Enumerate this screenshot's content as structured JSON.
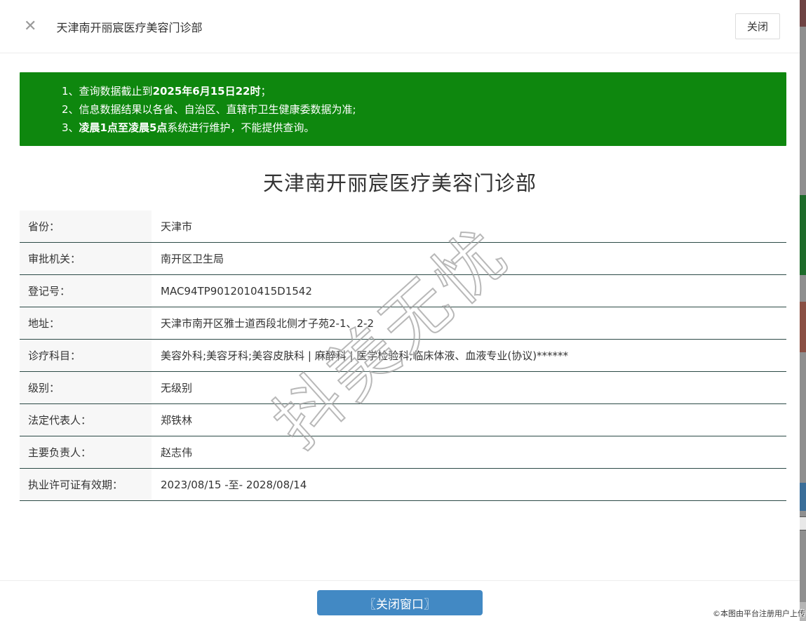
{
  "header": {
    "close_icon": "✕",
    "title": "天津南开丽宸医疗美容门诊部",
    "close_button_label": "关闭"
  },
  "notice": {
    "items": [
      {
        "num": "1、",
        "pre": "查询数据截止到",
        "bold": "2025年6月15日22时",
        "post": "；"
      },
      {
        "num": "2、",
        "pre": "信息数据结果以各省、自治区、直辖市卫生健康委数据为准;",
        "bold": "",
        "post": ""
      },
      {
        "num": "3、",
        "pre": "",
        "bold": "凌晨1点至凌晨5点",
        "post": "系统进行维护，不能提供查询。"
      }
    ]
  },
  "detail": {
    "title": "天津南开丽宸医疗美容门诊部",
    "rows": [
      {
        "label": "省份：",
        "value": "天津市"
      },
      {
        "label": "审批机关：",
        "value": "南开区卫生局"
      },
      {
        "label": "登记号：",
        "value": "MAC94TP9012010415D1542"
      },
      {
        "label": "地址：",
        "value": "天津市南开区雅士道西段北侧才子苑2-1、2-2"
      },
      {
        "label": "诊疗科目：",
        "value": "美容外科;美容牙科;美容皮肤科 | 麻醉科 | 医学检验科;临床体液、血液专业(协议)******"
      },
      {
        "label": "级别：",
        "value": "无级别"
      },
      {
        "label": "法定代表人：",
        "value": "郑铁林"
      },
      {
        "label": "主要负责人：",
        "value": "赵志伟"
      },
      {
        "label": "执业许可证有效期：",
        "value": "2023/08/15 -至- 2028/08/14"
      }
    ]
  },
  "watermark": "抖美无忧",
  "footer": {
    "close_window_button": "〖关闭窗口〗",
    "copyright": "©本图由平台注册用户上传"
  },
  "colors": {
    "notice_green": "#0e870e",
    "button_blue": "#4289c4",
    "row_border": "#2c4a46",
    "label_bg": "#f7f7f7"
  }
}
